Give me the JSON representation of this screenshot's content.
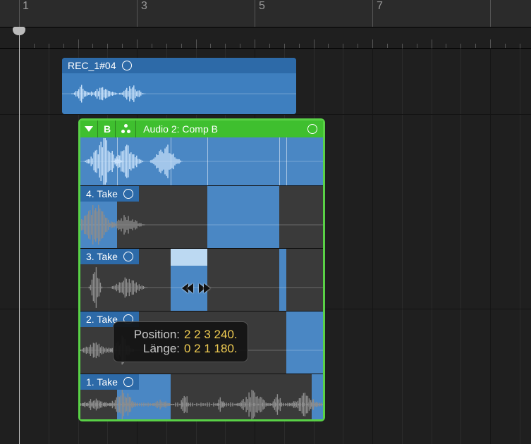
{
  "ruler": {
    "labels": [
      "1",
      "3",
      "5",
      "7"
    ]
  },
  "rec_region": {
    "name": "REC_1#04"
  },
  "take_folder": {
    "comp_letter": "B",
    "title": "Audio 2: Comp B",
    "takes": [
      {
        "label": "4. Take"
      },
      {
        "label": "3. Take"
      },
      {
        "label": "2. Take"
      },
      {
        "label": "1. Take"
      }
    ]
  },
  "tooltip": {
    "pos_label": "Position:",
    "pos_value": "2 2 3 240.",
    "len_label": "Länge:",
    "len_value": "0 2 1 180."
  }
}
